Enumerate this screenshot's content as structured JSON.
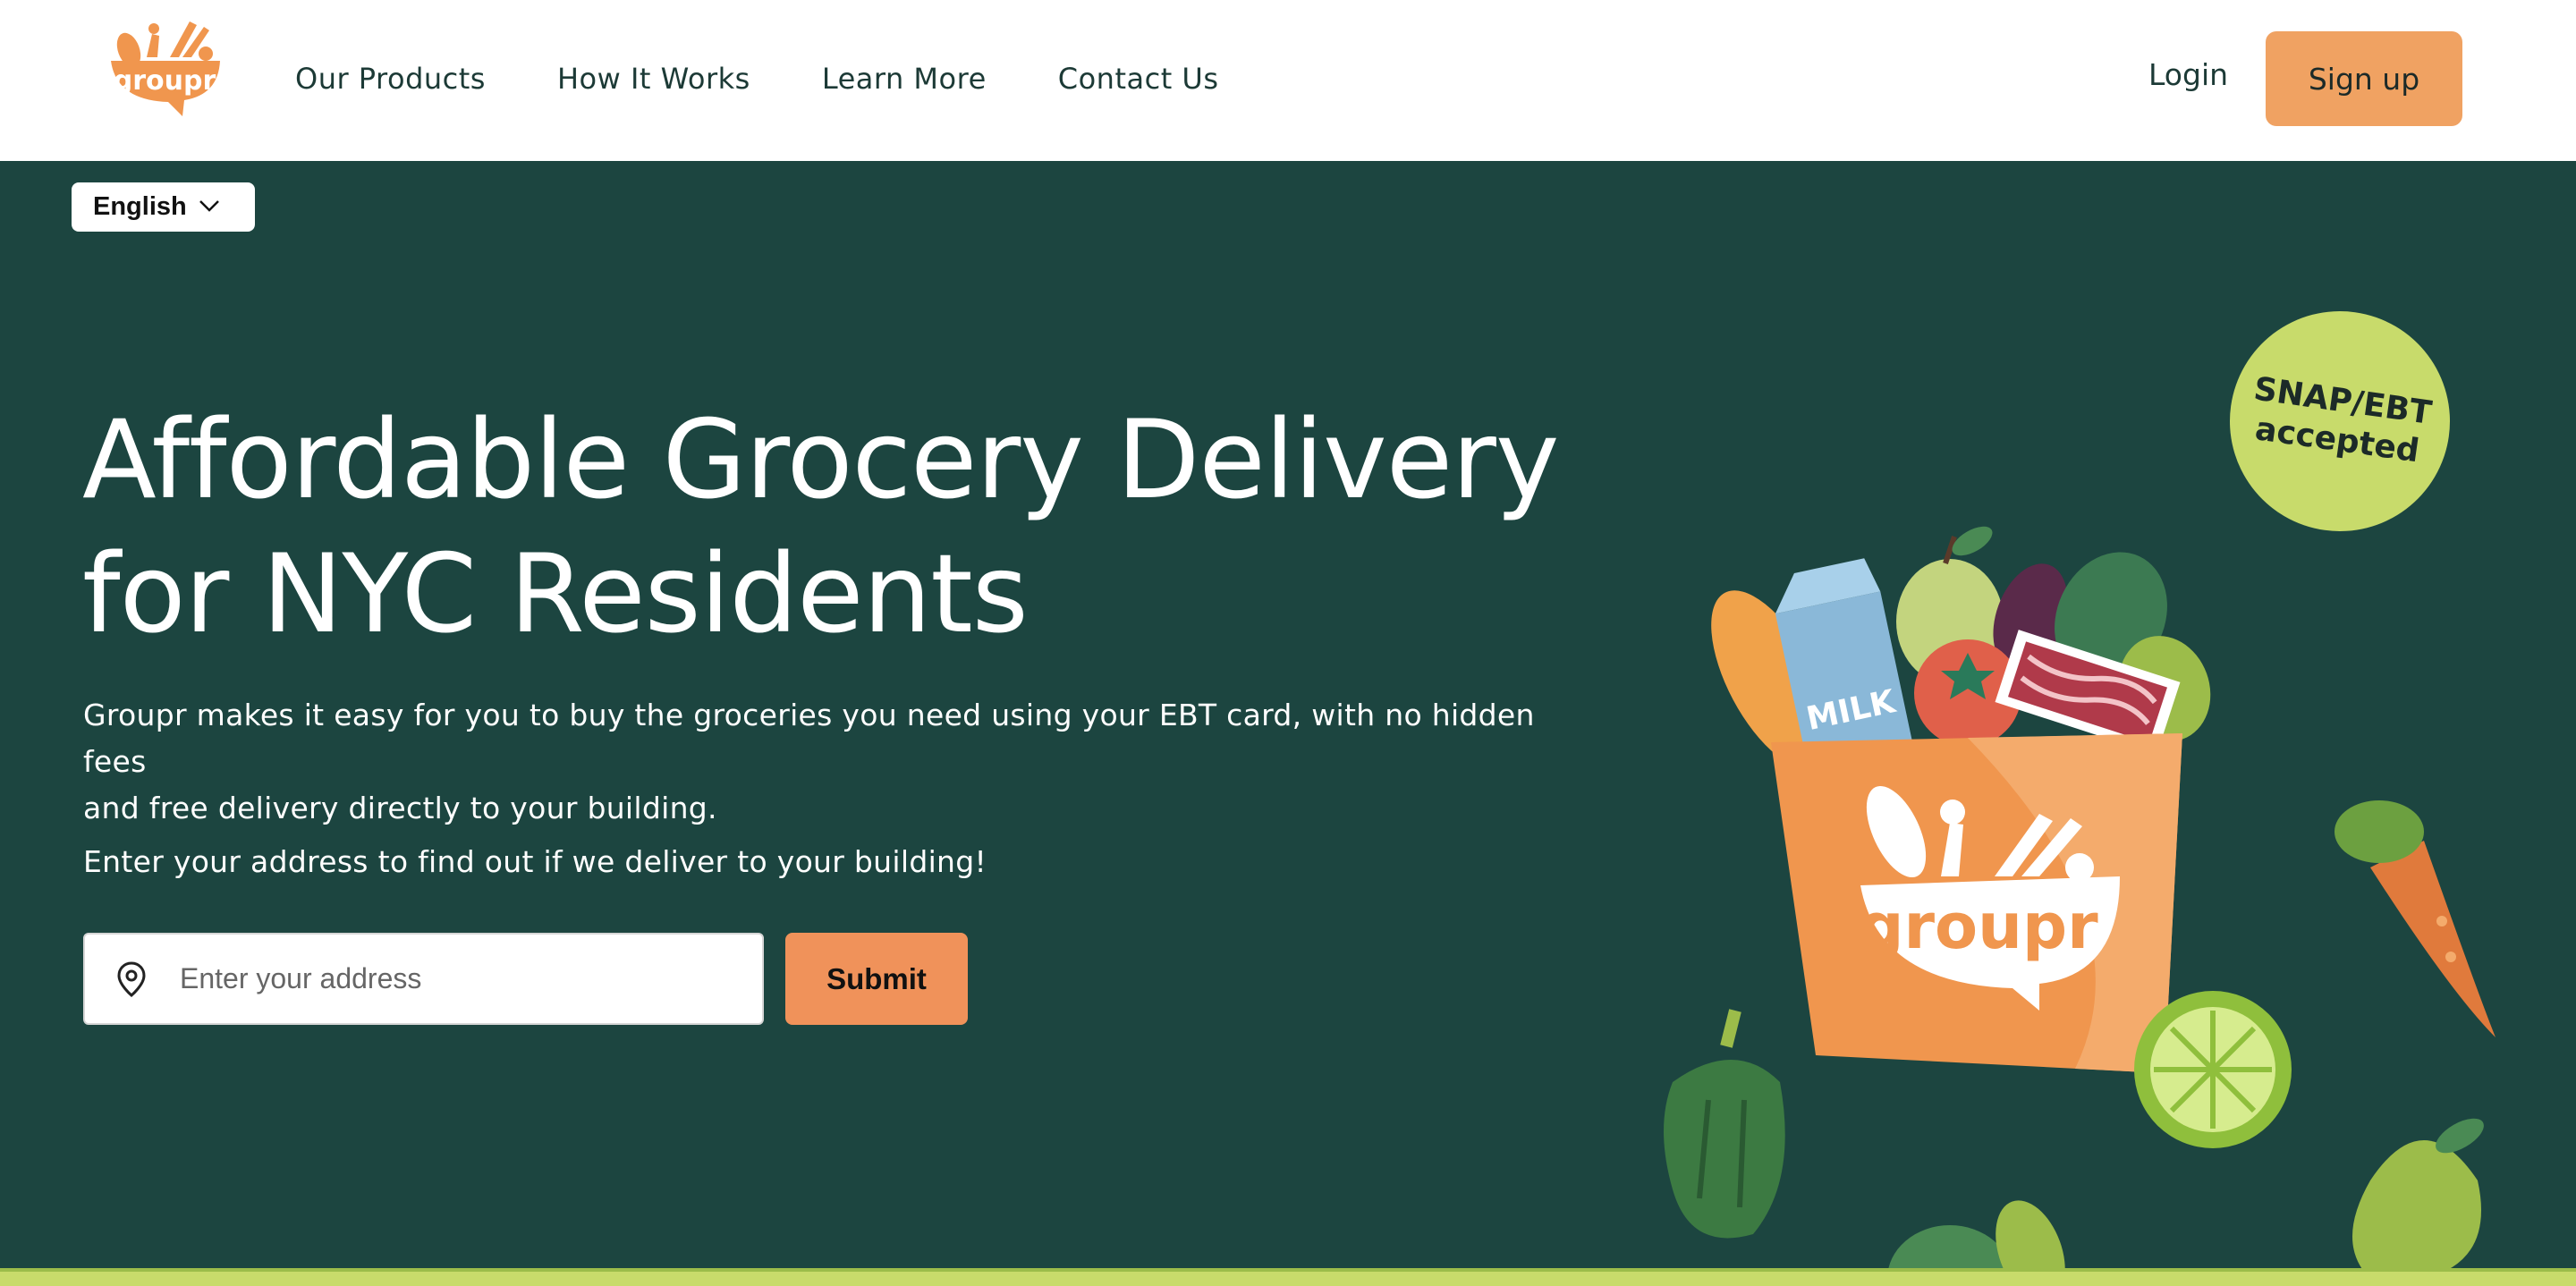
{
  "brand": {
    "name": "groupr"
  },
  "nav": {
    "items": [
      {
        "label": "Our Products"
      },
      {
        "label": "How It Works"
      },
      {
        "label": "Learn More"
      },
      {
        "label": "Contact Us"
      }
    ],
    "login_label": "Login",
    "signup_label": "Sign up"
  },
  "language": {
    "selected": "English"
  },
  "hero": {
    "title_line1": "Affordable Grocery Delivery",
    "title_line2": "for NYC Residents",
    "subtitle_line1": "Groupr makes it easy for you to buy the groceries you need using your EBT card, with no hidden fees",
    "subtitle_line2": "and free delivery directly to your building.",
    "cta_text": "Enter your address to find out if we deliver to your building!"
  },
  "address_form": {
    "placeholder": "Enter your address",
    "value": "",
    "submit_label": "Submit"
  },
  "badge": {
    "line1": "SNAP/EBT",
    "line2": "accepted"
  },
  "illustration": {
    "bag_logo": "groupr",
    "milk_label": "MILK"
  },
  "colors": {
    "header_bg": "#ffffff",
    "hero_bg": "#1c4540",
    "accent_orange": "#f0a262",
    "badge_green": "#c8db6b",
    "text_dark": "#1c3a36"
  },
  "icons": [
    "groupr-logo",
    "chevron-down-icon",
    "location-pin-icon"
  ]
}
